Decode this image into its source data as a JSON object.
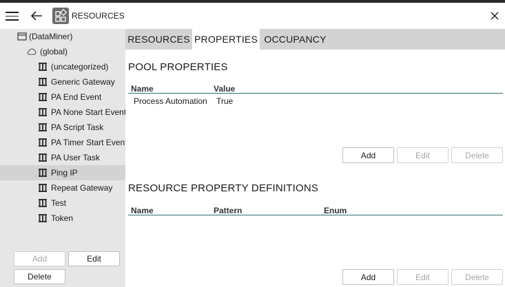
{
  "window": {
    "title": "RESOURCES",
    "menu_icon": "hamburger-menu-icon",
    "back_icon": "back-arrow-icon",
    "app_icon": "resources-app-icon",
    "close_icon": "close-icon"
  },
  "tree": {
    "root": {
      "label": "(DataMiner)",
      "icon": "window-icon"
    },
    "global": {
      "label": "(global)",
      "icon": "cloud-icon"
    },
    "items": [
      {
        "label": "(uncategorized)",
        "icon": "resource-pool-icon"
      },
      {
        "label": "Generic Gateway",
        "icon": "resource-pool-icon"
      },
      {
        "label": "PA End Event",
        "icon": "resource-pool-icon"
      },
      {
        "label": "PA None Start Event",
        "icon": "resource-pool-icon"
      },
      {
        "label": "PA Script Task",
        "icon": "resource-pool-icon"
      },
      {
        "label": "PA Timer Start Event",
        "icon": "resource-pool-icon"
      },
      {
        "label": "PA User Task",
        "icon": "resource-pool-icon"
      },
      {
        "label": "Ping IP",
        "icon": "resource-pool-icon",
        "selected": true
      },
      {
        "label": "Repeat Gateway",
        "icon": "resource-pool-icon"
      },
      {
        "label": "Test",
        "icon": "resource-pool-icon"
      },
      {
        "label": "Token",
        "icon": "resource-pool-icon"
      }
    ]
  },
  "sidebar_buttons": {
    "add": "Add",
    "edit": "Edit",
    "delete": "Delete"
  },
  "tabs": [
    {
      "label": "RESOURCES",
      "active": false
    },
    {
      "label": "PROPERTIES",
      "active": true
    },
    {
      "label": "OCCUPANCY",
      "active": false
    }
  ],
  "pool_properties": {
    "title": "POOL PROPERTIES",
    "columns": [
      "Name",
      "Value"
    ],
    "rows": [
      {
        "name": "Process Automation",
        "value": "True"
      }
    ],
    "buttons": {
      "add": "Add",
      "edit": "Edit",
      "delete": "Delete"
    }
  },
  "resource_property_definitions": {
    "title": "RESOURCE PROPERTY DEFINITIONS",
    "columns": [
      "Name",
      "Pattern",
      "Enum"
    ],
    "rows": [],
    "buttons": {
      "add": "Add",
      "edit": "Edit",
      "delete": "Delete"
    }
  },
  "colors": {
    "sidebar_bg": "#e6e6e6",
    "tabbar_bg": "#d3d3d3",
    "selected_row": "#d3d3d3",
    "header_rule": "#2d6b73",
    "top_strip": "#2b2b2b"
  }
}
